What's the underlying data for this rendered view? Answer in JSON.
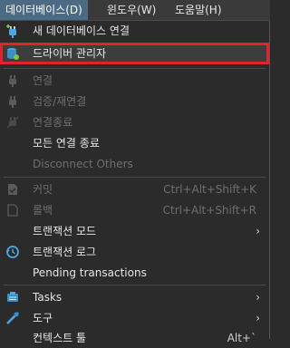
{
  "menubar": {
    "items": [
      {
        "label": "데이터베이스(D)"
      },
      {
        "label": "윈도우(W)"
      },
      {
        "label": "도움말(H)"
      }
    ]
  },
  "menu": {
    "items": [
      {
        "label": "새 데이터베이스 연결",
        "icon": "plug-plus-icon"
      },
      {
        "label": "드라이버 관리자",
        "icon": "database-driver-icon"
      },
      {
        "label": "연결",
        "icon": "plug-icon"
      },
      {
        "label": "검증/재연결",
        "icon": "reconnect-icon"
      },
      {
        "label": "연결종료",
        "icon": "disconnect-icon"
      },
      {
        "label": "모든 연결 종료"
      },
      {
        "label": "Disconnect Others"
      },
      {
        "label": "커밋",
        "accel": "Ctrl+Alt+Shift+K",
        "icon": "commit-icon"
      },
      {
        "label": "롤백",
        "accel": "Ctrl+Alt+Shift+R",
        "icon": "rollback-icon"
      },
      {
        "label": "트랜잭션 모드",
        "submenu": "›"
      },
      {
        "label": "트랜잭션 로그",
        "icon": "transaction-log-icon"
      },
      {
        "label": "Pending transactions"
      },
      {
        "label": "Tasks",
        "icon": "tasks-icon",
        "submenu": "›"
      },
      {
        "label": "도구",
        "icon": "tools-icon",
        "submenu": "›"
      },
      {
        "label": "컨텍스트 툴",
        "accel": "Alt+`"
      }
    ]
  }
}
